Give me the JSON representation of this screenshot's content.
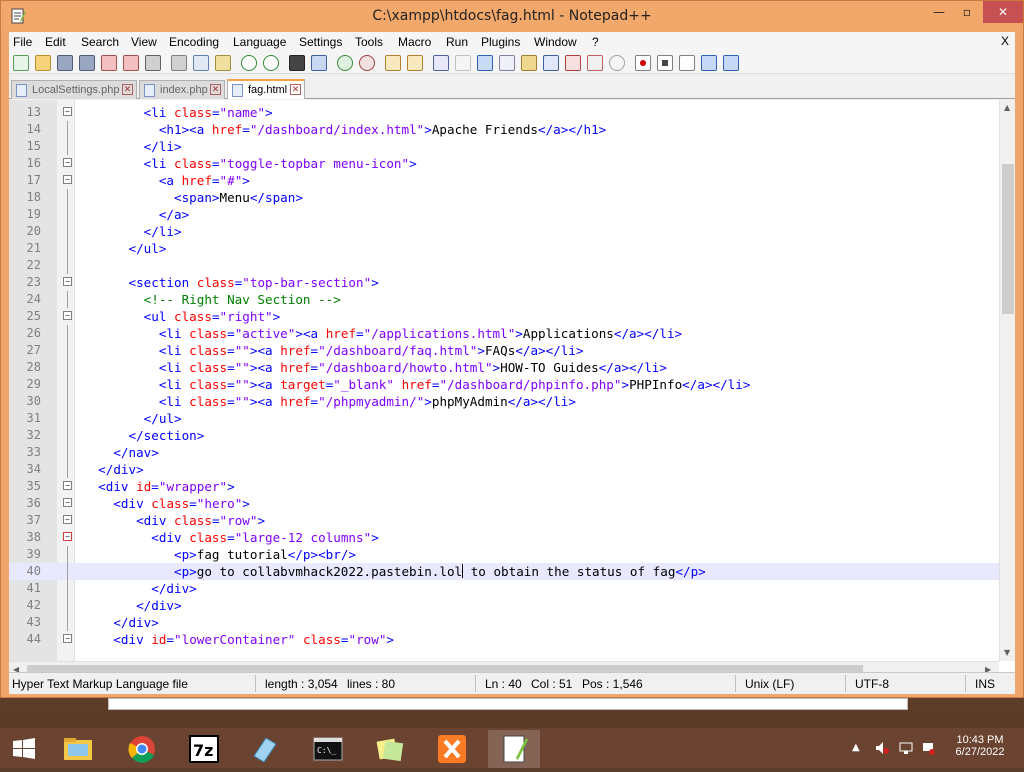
{
  "window": {
    "title": "C:\\xampp\\htdocs\\fag.html - Notepad++",
    "controls": [
      "minimize",
      "maximize",
      "close"
    ]
  },
  "menu": {
    "items": [
      "File",
      "Edit",
      "Search",
      "View",
      "Encoding",
      "Language",
      "Settings",
      "Tools",
      "Macro",
      "Run",
      "Plugins",
      "Window",
      "?"
    ],
    "close_label": "X"
  },
  "tabs": [
    {
      "label": "LocalSettings.php",
      "active": false
    },
    {
      "label": "index.php",
      "active": false
    },
    {
      "label": "fag.html",
      "active": true
    }
  ],
  "editor": {
    "lines": [
      {
        "num": "13",
        "fold": "minus",
        "html": "        <span class=\"t\">&lt;li</span> <span class=\"a\">class</span><span class=\"t\">=</span><span class=\"s\">\"name\"</span><span class=\"t\">&gt;</span>"
      },
      {
        "num": "14",
        "fold": "line",
        "html": "          <span class=\"t\">&lt;h1&gt;&lt;a</span> <span class=\"a\">href</span><span class=\"t\">=</span><span class=\"s\">\"/dashboard/index.html\"</span><span class=\"t\">&gt;</span>Apache Friends<span class=\"t\">&lt;/a&gt;&lt;/h1&gt;</span>"
      },
      {
        "num": "15",
        "fold": "line",
        "html": "        <span class=\"t\">&lt;/li&gt;</span>"
      },
      {
        "num": "16",
        "fold": "minus",
        "html": "        <span class=\"t\">&lt;li</span> <span class=\"a\">class</span><span class=\"t\">=</span><span class=\"s\">\"toggle-topbar menu-icon\"</span><span class=\"t\">&gt;</span>"
      },
      {
        "num": "17",
        "fold": "minus",
        "html": "          <span class=\"t\">&lt;a</span> <span class=\"a\">href</span><span class=\"t\">=</span><span class=\"s\">\"#\"</span><span class=\"t\">&gt;</span>"
      },
      {
        "num": "18",
        "fold": "line",
        "html": "            <span class=\"t\">&lt;span&gt;</span>Menu<span class=\"t\">&lt;/span&gt;</span>"
      },
      {
        "num": "19",
        "fold": "line",
        "html": "          <span class=\"t\">&lt;/a&gt;</span>"
      },
      {
        "num": "20",
        "fold": "line",
        "html": "        <span class=\"t\">&lt;/li&gt;</span>"
      },
      {
        "num": "21",
        "fold": "line",
        "html": "      <span class=\"t\">&lt;/ul&gt;</span>"
      },
      {
        "num": "22",
        "fold": "line",
        "html": ""
      },
      {
        "num": "23",
        "fold": "minus",
        "html": "      <span class=\"t\">&lt;section</span> <span class=\"a\">class</span><span class=\"t\">=</span><span class=\"s\">\"top-bar-section\"</span><span class=\"t\">&gt;</span>"
      },
      {
        "num": "24",
        "fold": "line",
        "html": "        <span class=\"c\">&lt;!-- Right Nav Section --&gt;</span>"
      },
      {
        "num": "25",
        "fold": "minus",
        "html": "        <span class=\"t\">&lt;ul</span> <span class=\"a\">class</span><span class=\"t\">=</span><span class=\"s\">\"right\"</span><span class=\"t\">&gt;</span>"
      },
      {
        "num": "26",
        "fold": "line",
        "html": "          <span class=\"t\">&lt;li</span> <span class=\"a\">class</span><span class=\"t\">=</span><span class=\"s\">\"active\"</span><span class=\"t\">&gt;&lt;a</span> <span class=\"a\">href</span><span class=\"t\">=</span><span class=\"s\">\"/applications.html\"</span><span class=\"t\">&gt;</span>Applications<span class=\"t\">&lt;/a&gt;&lt;/li&gt;</span>"
      },
      {
        "num": "27",
        "fold": "line",
        "html": "          <span class=\"t\">&lt;li</span> <span class=\"a\">class</span><span class=\"t\">=</span><span class=\"s\">\"\"</span><span class=\"t\">&gt;&lt;a</span> <span class=\"a\">href</span><span class=\"t\">=</span><span class=\"s\">\"/dashboard/faq.html\"</span><span class=\"t\">&gt;</span>FAQs<span class=\"t\">&lt;/a&gt;&lt;/li&gt;</span>"
      },
      {
        "num": "28",
        "fold": "line",
        "html": "          <span class=\"t\">&lt;li</span> <span class=\"a\">class</span><span class=\"t\">=</span><span class=\"s\">\"\"</span><span class=\"t\">&gt;&lt;a</span> <span class=\"a\">href</span><span class=\"t\">=</span><span class=\"s\">\"/dashboard/howto.html\"</span><span class=\"t\">&gt;</span>HOW-TO Guides<span class=\"t\">&lt;/a&gt;&lt;/li&gt;</span>"
      },
      {
        "num": "29",
        "fold": "line",
        "html": "          <span class=\"t\">&lt;li</span> <span class=\"a\">class</span><span class=\"t\">=</span><span class=\"s\">\"\"</span><span class=\"t\">&gt;&lt;a</span> <span class=\"a\">target</span><span class=\"t\">=</span><span class=\"s\">\"_blank\"</span> <span class=\"a\">href</span><span class=\"t\">=</span><span class=\"s\">\"/dashboard/phpinfo.php\"</span><span class=\"t\">&gt;</span>PHPInfo<span class=\"t\">&lt;/a&gt;&lt;/li&gt;</span>"
      },
      {
        "num": "30",
        "fold": "line",
        "html": "          <span class=\"t\">&lt;li</span> <span class=\"a\">class</span><span class=\"t\">=</span><span class=\"s\">\"\"</span><span class=\"t\">&gt;&lt;a</span> <span class=\"a\">href</span><span class=\"t\">=</span><span class=\"s\">\"/phpmyadmin/\"</span><span class=\"t\">&gt;</span>phpMyAdmin<span class=\"t\">&lt;/a&gt;&lt;/li&gt;</span>"
      },
      {
        "num": "31",
        "fold": "line",
        "html": "        <span class=\"t\">&lt;/ul&gt;</span>"
      },
      {
        "num": "32",
        "fold": "line",
        "html": "      <span class=\"t\">&lt;/section&gt;</span>"
      },
      {
        "num": "33",
        "fold": "line",
        "html": "    <span class=\"t\">&lt;/nav&gt;</span>"
      },
      {
        "num": "34",
        "fold": "line",
        "html": "  <span class=\"t\">&lt;/div&gt;</span>"
      },
      {
        "num": "35",
        "fold": "minus",
        "html": "  <span class=\"t\">&lt;div</span> <span class=\"a\">id</span><span class=\"t\">=</span><span class=\"s\">\"wrapper\"</span><span class=\"t\">&gt;</span>"
      },
      {
        "num": "36",
        "fold": "minus",
        "html": "    <span class=\"t\">&lt;div</span> <span class=\"a\">class</span><span class=\"t\">=</span><span class=\"s\">\"hero\"</span><span class=\"t\">&gt;</span>"
      },
      {
        "num": "37",
        "fold": "minus",
        "html": "       <span class=\"t\">&lt;div</span> <span class=\"a\">class</span><span class=\"t\">=</span><span class=\"s\">\"row\"</span><span class=\"t\">&gt;</span>"
      },
      {
        "num": "38",
        "fold": "minus-red",
        "html": "         <span class=\"t\">&lt;div</span> <span class=\"a\">class</span><span class=\"t\">=</span><span class=\"s\">\"large-12 columns\"</span><span class=\"t\">&gt;</span>"
      },
      {
        "num": "39",
        "fold": "line",
        "html": "            <span class=\"t\">&lt;p&gt;</span>fag tutorial<span class=\"t\">&lt;/p&gt;&lt;br/&gt;</span>"
      },
      {
        "num": "40",
        "fold": "line",
        "current": true,
        "html": "            <span class=\"t\">&lt;p&gt;</span>go to collabvmhack2022.pastebin.lol<span class=\"caret\"></span> to obtain the status of fag<span class=\"t\">&lt;/p&gt;</span>"
      },
      {
        "num": "41",
        "fold": "line",
        "html": "         <span class=\"t\">&lt;/div&gt;</span>"
      },
      {
        "num": "42",
        "fold": "line",
        "html": "       <span class=\"t\">&lt;/div&gt;</span>"
      },
      {
        "num": "43",
        "fold": "line",
        "html": "    <span class=\"t\">&lt;/div&gt;</span>"
      },
      {
        "num": "44",
        "fold": "minus",
        "html": "    <span class=\"t\">&lt;div</span> <span class=\"a\">id</span><span class=\"t\">=</span><span class=\"s\">\"lowerContainer\"</span> <span class=\"a\">class</span><span class=\"t\">=</span><span class=\"s\">\"row\"</span><span class=\"t\">&gt;</span>"
      }
    ]
  },
  "statusbar": {
    "filetype": "Hyper Text Markup Language file",
    "length": "length : 3,054",
    "lines": "lines : 80",
    "ln": "Ln : 40",
    "col": "Col : 51",
    "pos": "Pos : 1,546",
    "eol": "Unix (LF)",
    "encoding": "UTF-8",
    "mode": "INS"
  },
  "taskbar": {
    "apps": [
      "start",
      "file-explorer",
      "chrome",
      "7-zip",
      "notepad",
      "command-prompt",
      "sticky-notes",
      "xampp",
      "notepad-plus-plus"
    ],
    "clock_time": "10:43 PM",
    "clock_date": "6/27/2022"
  },
  "colors": {
    "window_frame": "#f3a86b",
    "taskbar": "#6b4331",
    "tag": "#0000ff",
    "attribute": "#ff0000",
    "string": "#8000ff",
    "comment": "#008000",
    "current_line": "#e8e8ff"
  }
}
